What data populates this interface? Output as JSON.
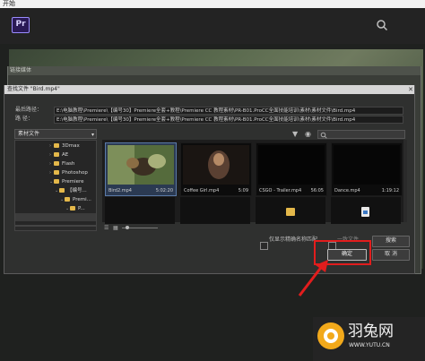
{
  "titlebar": {
    "title": "开始"
  },
  "app": {
    "logo_text": "Pr",
    "search_icon": "search-icon"
  },
  "outer_dialog": {
    "title": "链接媒体"
  },
  "dialog": {
    "title": "查找文件 \"Bird.mp4\"",
    "close_icon": "close-icon",
    "last_path_label": "最后路径：",
    "last_path_value": "E:\\电脑教程\\Premiere\\【编号30】Premiere全套+教程\\Premiere CC 教程素材\\PR-B01.ProCC全面技能培训\\素材\\素材文件\\Bird.mp4",
    "path_label": "路 径：",
    "path_value": "E:\\电脑教程\\Premiere\\【编号30】Premiere全套+教程\\Premiere CC 教程素材\\PR-B01.ProCC全面技能培训\\素材\\素材文件\\Bird.mp4",
    "location_combo": "素材文件",
    "tree": [
      {
        "label": "3Dmax"
      },
      {
        "label": "AE"
      },
      {
        "label": "Flash"
      },
      {
        "label": "Photoshop"
      },
      {
        "label": "Premiere"
      },
      {
        "label": "【编号..."
      },
      {
        "label": "Premi..."
      },
      {
        "label": "P..."
      },
      {
        "label": ""
      }
    ],
    "files": [
      {
        "name": "Bird2.mp4",
        "duration": "5:02:20",
        "selected": true
      },
      {
        "name": "Coffee Girl.mp4",
        "duration": "5:09",
        "selected": false
      },
      {
        "name": "CSGO - Trailer.mp4",
        "duration": "56:05",
        "selected": false
      },
      {
        "name": "Dance.mp4",
        "duration": "1:19:12",
        "selected": false
      }
    ],
    "checkbox_label": "仅显示精确名称匹配",
    "hint_label": "一致文件",
    "buttons": {
      "find": "搜索",
      "ok": "确定",
      "cancel": "取 消"
    }
  },
  "watermark": {
    "text": "羽兔网",
    "url": "WWW.YUTU.CN"
  },
  "colors": {
    "highlight": "#e21d1d",
    "accent": "#9a8cff"
  }
}
